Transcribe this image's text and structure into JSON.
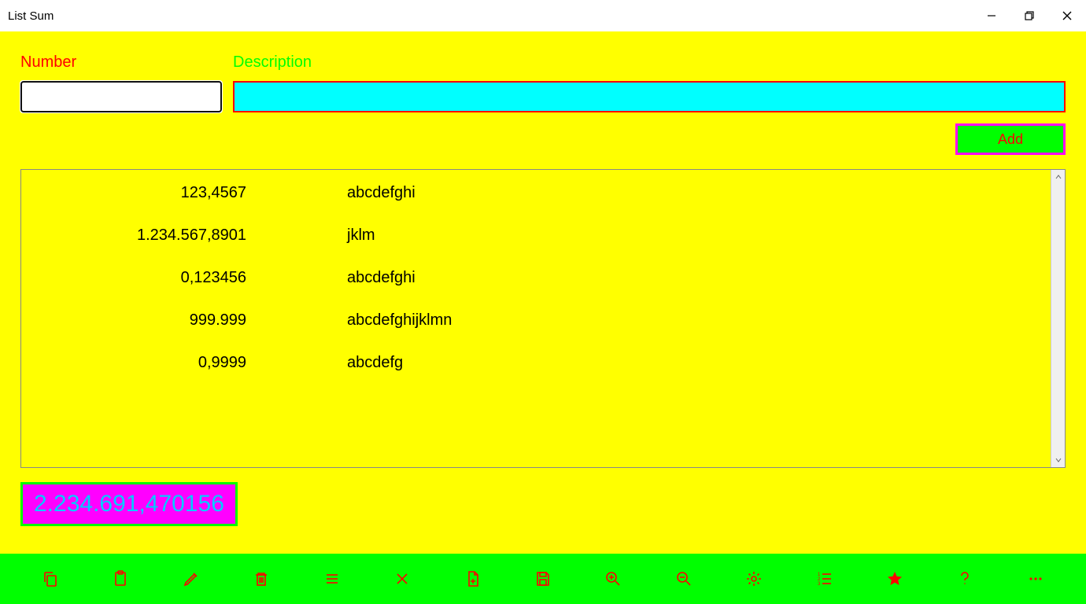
{
  "window": {
    "title": "List Sum"
  },
  "form": {
    "number_label": "Number",
    "description_label": "Description",
    "number_value": "",
    "description_value": "",
    "add_button_label": "Add"
  },
  "list": {
    "items": [
      {
        "number": "123,4567",
        "description": "abcdefghi"
      },
      {
        "number": "1.234.567,8901",
        "description": "jklm"
      },
      {
        "number": "0,123456",
        "description": "abcdefghi"
      },
      {
        "number": "999.999",
        "description": "abcdefghijklmn"
      },
      {
        "number": "0,9999",
        "description": "abcdefg"
      }
    ]
  },
  "sum": "2.234.691,470156",
  "toolbar": {
    "copy": "copy",
    "paste": "paste",
    "edit": "edit",
    "delete": "delete",
    "list": "list",
    "close": "close",
    "newfile": "new-file",
    "save": "save",
    "zoomin": "zoom-in",
    "zoomout": "zoom-out",
    "settings": "settings",
    "numlist": "numbered-list",
    "star": "favorite",
    "help": "help",
    "more": "more"
  }
}
